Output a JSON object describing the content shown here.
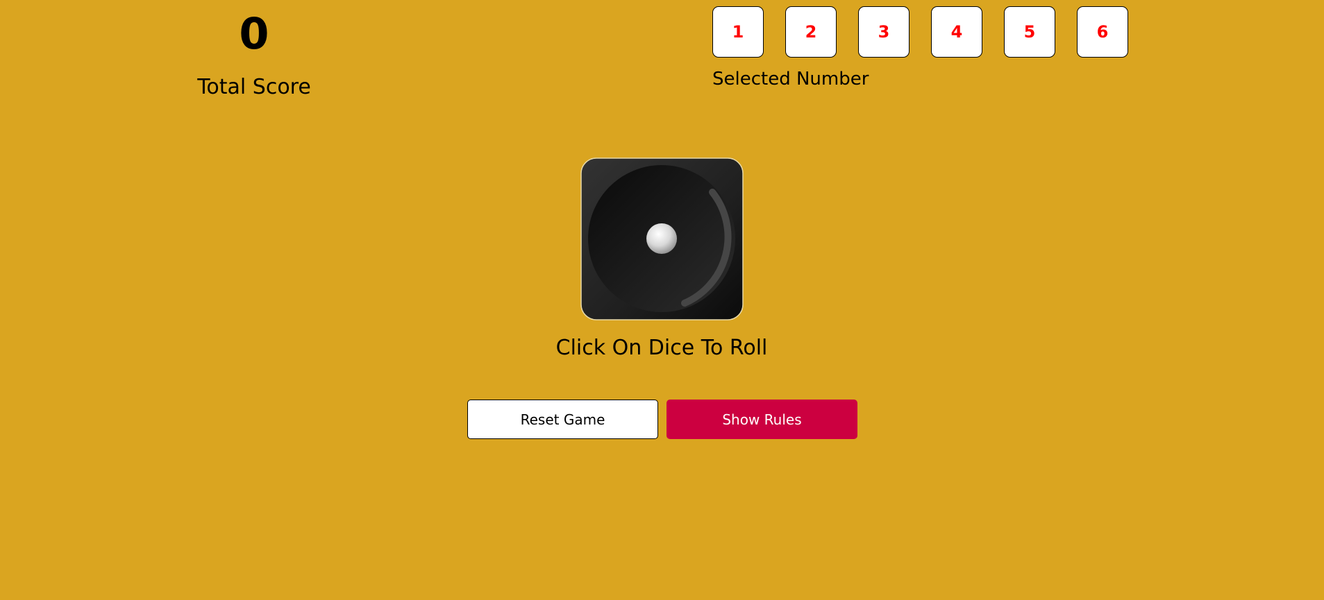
{
  "score": {
    "value": "0",
    "label": "Total Score"
  },
  "number_selector": {
    "numbers": [
      "1",
      "2",
      "3",
      "4",
      "5",
      "6"
    ],
    "label": "Selected Number"
  },
  "dice": {
    "face_value": 1,
    "icon": "dice-one-icon"
  },
  "roll_prompt": "Click On Dice To Roll",
  "actions": {
    "reset_label": "Reset Game",
    "rules_label": "Show Rules"
  },
  "colors": {
    "background": "#DAA520",
    "number_text": "#FF0000",
    "rules_button": "#CC0040",
    "dice_body": "#1E1E1E"
  }
}
